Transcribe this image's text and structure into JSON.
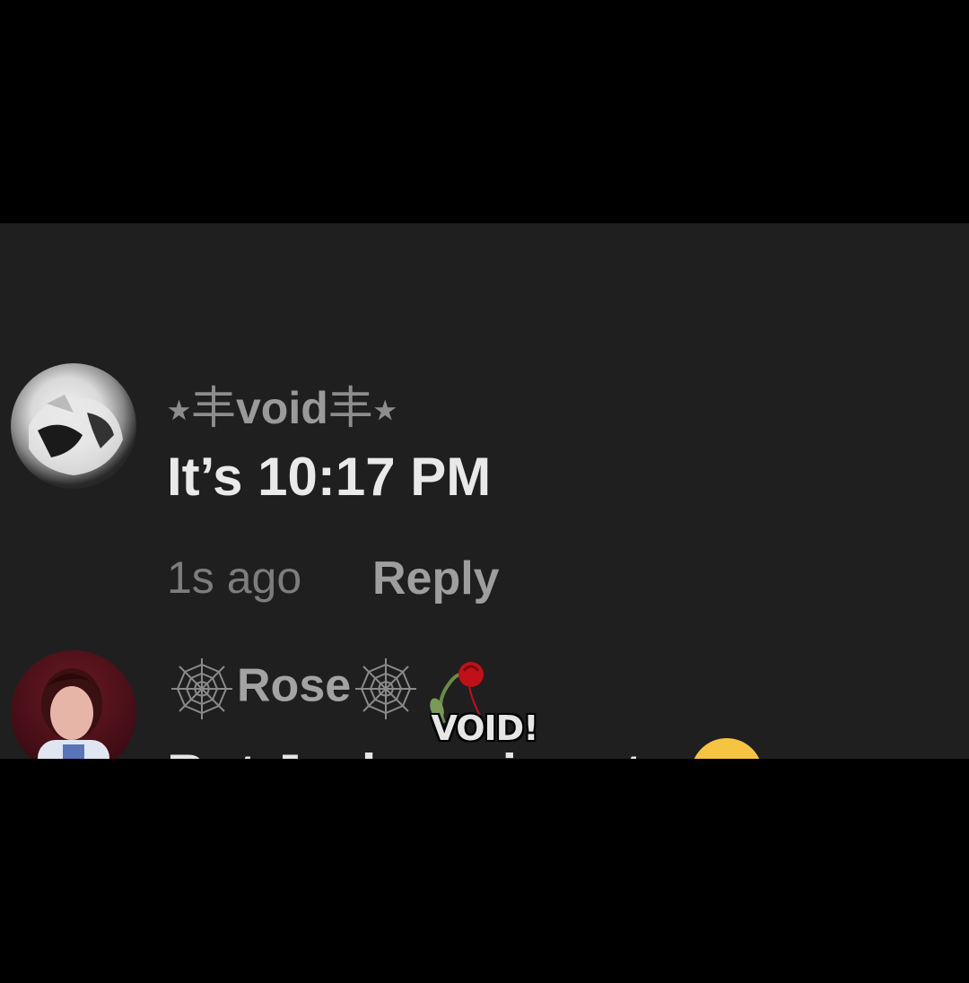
{
  "comments": [
    {
      "username_prefix": "⭑丰",
      "username_core": "void",
      "username_suffix": "丰⭑",
      "text": "It’s 10:17 PM",
      "time": "1s ago",
      "reply_label": "Reply",
      "avatar_icon": "avatar-icon"
    },
    {
      "username": "Rose",
      "text": "But Jackson is cute",
      "avatar_icon": "avatar-icon",
      "username_icons": [
        "spider-web-icon",
        "spider-web-icon",
        "wilted-rose-icon"
      ],
      "emoji": "crying-laughing-emoji-icon"
    }
  ],
  "caption": "VOID!",
  "colors": {
    "frame_bg": "#1f1f1f",
    "letterbox": "#000000",
    "username": "#9a9a9a",
    "comment_text": "#e9e9e9",
    "meta": "#7d7d7d"
  }
}
